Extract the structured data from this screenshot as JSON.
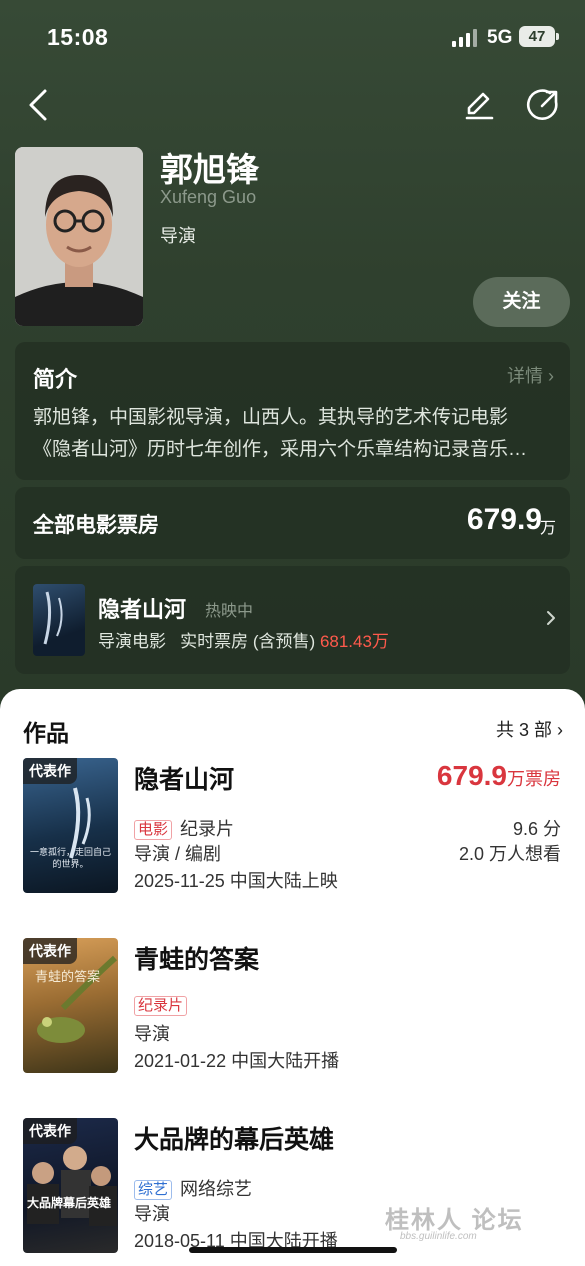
{
  "status_bar": {
    "time": "15:08",
    "network": "5G",
    "battery": "47"
  },
  "profile": {
    "name": "郭旭锋",
    "name_en": "Xufeng Guo",
    "role": "导演",
    "follow_label": "关注"
  },
  "intro": {
    "title": "简介",
    "more_label": "详情",
    "lines": [
      "郭旭锋，中国影视导演，山西人。其执导的艺术传记电影",
      "《隐者山河》历时七年创作，采用六个乐章结构记录音乐…"
    ]
  },
  "box_office": {
    "label": "全部电影票房",
    "value": "679.9",
    "unit": "万"
  },
  "now_showing": {
    "title": "隐者山河",
    "status": "热映中",
    "sub_prefix": "导演电影   实时票房 (含预售) ",
    "value": "681.43万"
  },
  "works": {
    "title": "作品",
    "count_label": "共 3 部",
    "items": [
      {
        "tag": "代表作",
        "title": "隐者山河",
        "box_office_value": "679.9",
        "box_office_unit": "万票房",
        "genre_chip": "电影",
        "genre": "纪录片",
        "role": "导演 / 编剧",
        "release": "2025-11-25 中国大陆上映",
        "score": "9.6 分",
        "wants": "2.0 万人想看",
        "poster_text": "一意孤行，走回自己的世界。"
      },
      {
        "tag": "代表作",
        "title": "青蛙的答案",
        "genre_chip": "纪录片",
        "role": "导演",
        "release": "2021-01-22 中国大陆开播",
        "poster_text": "青蛙的答案"
      },
      {
        "tag": "代表作",
        "title": "大品牌的幕后英雄",
        "genre_chip": "综艺",
        "genre": "网络综艺",
        "role": "导演",
        "release": "2018-05-11 中国大陆开播",
        "poster_text": "大品牌幕后英雄"
      }
    ]
  },
  "watermark": {
    "main": "桂林人 论坛",
    "sub": "bbs.guilinlife.com"
  },
  "colors": {
    "header_bg": "#2c3d2c",
    "accent_red": "#d9363e",
    "live_red": "#ff5a4c",
    "chip_blue": "#2f6fd1"
  }
}
